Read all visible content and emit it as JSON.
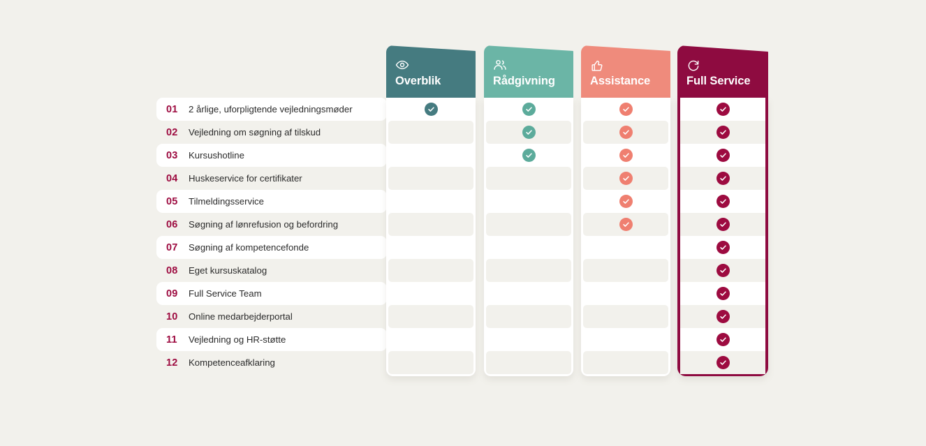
{
  "page": {
    "background": "#f2f1ec",
    "accent": "#9d0b40"
  },
  "rows": [
    {
      "num": "01",
      "label": "2 årlige, uforpligtende vejledningsmøder"
    },
    {
      "num": "02",
      "label": "Vejledning om søgning af tilskud"
    },
    {
      "num": "03",
      "label": "Kursushotline"
    },
    {
      "num": "04",
      "label": "Huskeservice for certifikater"
    },
    {
      "num": "05",
      "label": "Tilmeldingsservice"
    },
    {
      "num": "06",
      "label": "Søgning af lønrefusion og befordring"
    },
    {
      "num": "07",
      "label": "Søgning af kompetencefonde"
    },
    {
      "num": "08",
      "label": "Eget kursuskatalog"
    },
    {
      "num": "09",
      "label": "Full Service Team"
    },
    {
      "num": "10",
      "label": "Online medarbejderportal"
    },
    {
      "num": "11",
      "label": "Vejledning og HR-støtte"
    },
    {
      "num": "12",
      "label": "Kompetenceafklaring"
    }
  ],
  "columns": [
    {
      "title": "Overblik",
      "icon": "eye-icon",
      "header_color": "#457b80",
      "check_color": "#457b80",
      "featured": false,
      "checks": [
        true,
        false,
        false,
        false,
        false,
        false,
        false,
        false,
        false,
        false,
        false,
        false
      ]
    },
    {
      "title": "Rådgivning",
      "icon": "users-icon",
      "header_color": "#6bb5a6",
      "check_color": "#5cab9b",
      "featured": false,
      "checks": [
        true,
        true,
        true,
        false,
        false,
        false,
        false,
        false,
        false,
        false,
        false,
        false
      ]
    },
    {
      "title": "Assistance",
      "icon": "thumbs-up-icon",
      "header_color": "#ef8b7c",
      "check_color": "#ef7f70",
      "featured": false,
      "checks": [
        true,
        true,
        true,
        true,
        true,
        true,
        false,
        false,
        false,
        false,
        false,
        false
      ]
    },
    {
      "title": "Full Service",
      "icon": "refresh-icon",
      "header_color": "#8e0b40",
      "check_color": "#9d0b40",
      "featured": true,
      "checks": [
        true,
        true,
        true,
        true,
        true,
        true,
        true,
        true,
        true,
        true,
        true,
        true
      ]
    }
  ]
}
